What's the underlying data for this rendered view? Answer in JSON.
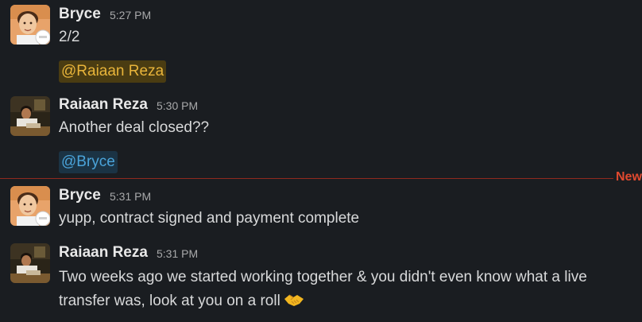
{
  "messages": [
    {
      "author": "Bryce",
      "time": "5:27 PM",
      "text": "2/2",
      "mention": "@Raiaan Reza",
      "avatar_icon": "bryce-avatar"
    },
    {
      "author": "Raiaan Reza",
      "time": "5:30 PM",
      "text": "Another deal closed??",
      "mention": "@Bryce",
      "avatar_icon": "raiaan-avatar"
    },
    {
      "author": "Bryce",
      "time": "5:31 PM",
      "text": "yupp, contract signed and payment complete",
      "avatar_icon": "bryce-avatar"
    },
    {
      "author": "Raiaan Reza",
      "time": "5:31 PM",
      "text_line1": "Two weeks ago we started working together & you didn't even know what a live",
      "text_line2": "transfer was, look at you on a roll",
      "emoji": "handshake-icon",
      "avatar_icon": "raiaan-avatar"
    }
  ],
  "divider": {
    "label": "New"
  },
  "colors": {
    "background": "#1a1d21",
    "mention_yellow_bg": "#4a3c12",
    "mention_yellow_text": "#e8b43a",
    "mention_blue_bg": "#1b3344",
    "mention_blue_text": "#4aa3d9",
    "new_divider": "#e0492f"
  }
}
